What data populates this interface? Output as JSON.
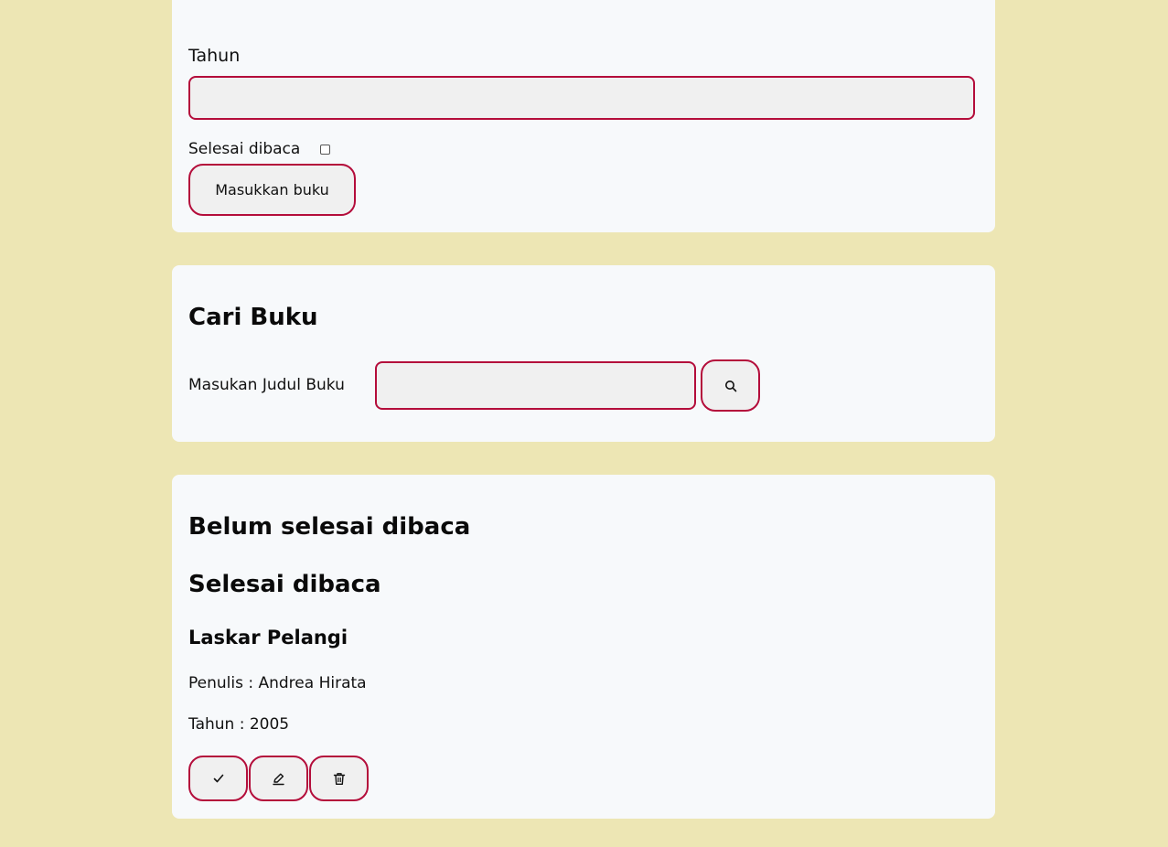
{
  "form": {
    "year_label": "Tahun",
    "year_value": "",
    "complete_label": "Selesai dibaca",
    "complete_checked": false,
    "submit_label": "Masukkan buku"
  },
  "search": {
    "title": "Cari Buku",
    "input_label": "Masukan Judul Buku",
    "input_value": "",
    "button_icon": "search-icon"
  },
  "shelves": {
    "incomplete_title": "Belum selesai dibaca",
    "complete_title": "Selesai dibaca",
    "books": [
      {
        "title": "Laskar Pelangi",
        "author_line": "Penulis : Andrea Hirata",
        "year_line": "Tahun : 2005",
        "actions": [
          "check-icon",
          "pencil-icon",
          "trash-icon"
        ]
      }
    ]
  },
  "colors": {
    "background": "#ede6b4",
    "card": "#f7f9fb",
    "accent_border": "#b40d3b",
    "input_fill": "#f0f0f0"
  }
}
